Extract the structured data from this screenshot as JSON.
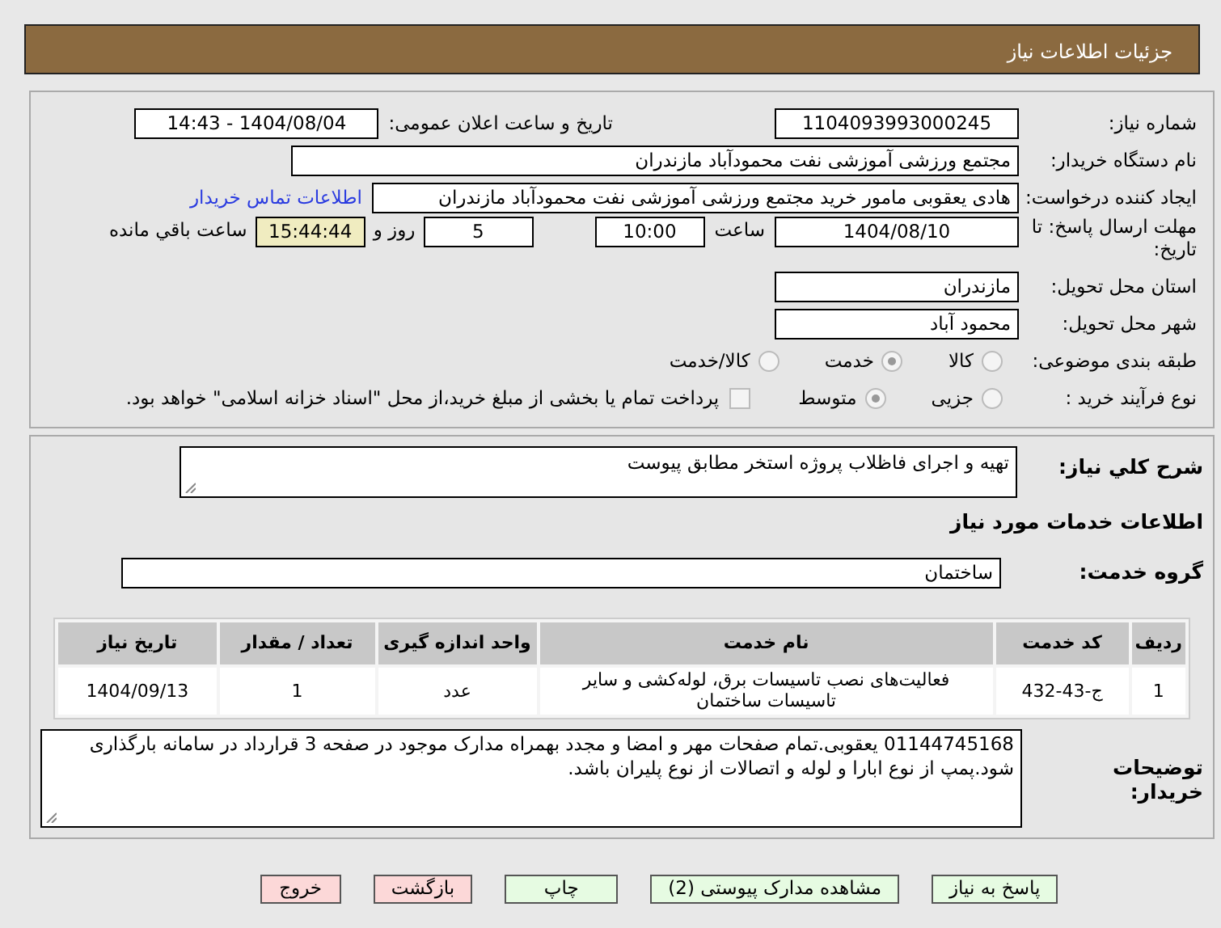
{
  "header": {
    "title": "جزئیات اطلاعات نیاز"
  },
  "need_number": {
    "label": "شماره نیاز:",
    "value": "1104093993000245"
  },
  "announce": {
    "label": "تاریخ و ساعت اعلان عمومی:",
    "value": "1404/08/04 - 14:43"
  },
  "buyer": {
    "label": "نام دستگاه خریدار:",
    "value": "مجتمع ورزشی آموزشی نفت محمودآباد مازندران"
  },
  "requester": {
    "label": "ایجاد کننده درخواست:",
    "value": "هادی یعقوبی مامور خرید مجتمع ورزشی آموزشی نفت محمودآباد مازندران",
    "link": "اطلاعات تماس خریدار"
  },
  "deadline": {
    "label": "مهلت ارسال پاسخ: تا تاریخ:",
    "date": "1404/08/10",
    "time_label": "ساعت",
    "time": "10:00",
    "days": "5",
    "days_label": "روز و",
    "remaining": "15:44:44",
    "remaining_label": "ساعت باقي مانده"
  },
  "province": {
    "label": "استان محل تحویل:",
    "value": "مازندران"
  },
  "city": {
    "label": "شهر محل تحویل:",
    "value": "محمود آباد"
  },
  "category": {
    "label": "طبقه بندی موضوعی:",
    "options": [
      {
        "label": "کالا",
        "selected": false
      },
      {
        "label": "خدمت",
        "selected": true
      },
      {
        "label": "کالا/خدمت",
        "selected": false
      }
    ]
  },
  "process": {
    "label": "نوع فرآیند خرید :",
    "options": [
      {
        "label": "جزیی",
        "selected": false
      },
      {
        "label": "متوسط",
        "selected": true
      }
    ],
    "payment": {
      "label": "پرداخت تمام یا بخشی از مبلغ خرید،از محل \"اسناد خزانه اسلامی\" خواهد بود.",
      "checked": false
    }
  },
  "summary": {
    "label": "شرح کلي نیاز:",
    "value": "تهیه و اجرای فاظلاب پروژه استخر مطابق پیوست"
  },
  "services_title": "اطلاعات خدمات مورد نیاز",
  "group": {
    "label": "گروه خدمت:",
    "value": "ساختمان"
  },
  "table": {
    "columns": [
      "ردیف",
      "کد خدمت",
      "نام خدمت",
      "واحد اندازه گیری",
      "تعداد / مقدار",
      "تاریخ نیاز"
    ],
    "rows": [
      [
        "1",
        "ج-43-432",
        "فعالیت‌های نصب تاسیسات برق، لوله‌کشی و سایر تاسیسات ساختمان",
        "عدد",
        "1",
        "1404/09/13"
      ]
    ]
  },
  "notes": {
    "label": "توضیحات خریدار:",
    "value": "01144745168 یعقوبی.تمام صفحات مهر و امضا و مجدد بهمراه مدارک موجود در صفحه 3 قرارداد در سامانه بارگذاری شود.پمپ از نوع ابارا و لوله و اتصالات از نوع پلیران باشد."
  },
  "buttons": [
    {
      "label": "پاسخ به نیاز",
      "kind": "go"
    },
    {
      "label": "مشاهده مدارک پیوستی (2)",
      "kind": "go"
    },
    {
      "label": "چاپ",
      "kind": "go"
    },
    {
      "label": "بازگشت",
      "kind": "exit"
    },
    {
      "label": "خروج",
      "kind": "exit"
    }
  ]
}
